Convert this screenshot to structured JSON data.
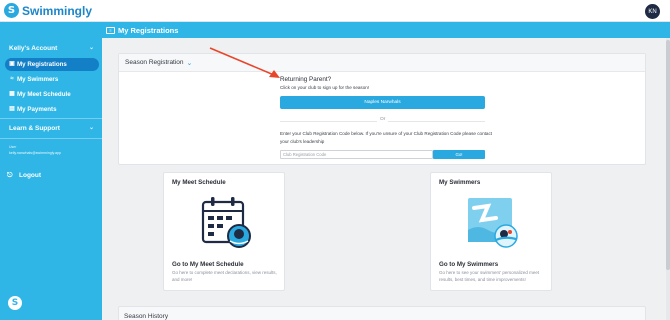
{
  "app": {
    "name": "Swimmingly",
    "user_initials": "KN"
  },
  "sidebar": {
    "account_title": "Kelly's Account",
    "items": [
      {
        "label": "My Registrations",
        "icon": "registration-icon",
        "active": true
      },
      {
        "label": "My Swimmers",
        "icon": "swimmer-icon",
        "active": false
      },
      {
        "label": "My Meet Schedule",
        "icon": "calendar-icon",
        "active": false
      },
      {
        "label": "My Payments",
        "icon": "receipt-icon",
        "active": false
      }
    ],
    "learn_title": "Learn & Support",
    "email_label": "User",
    "email": "kelly.nanwhals@swimmingly.app",
    "logout_label": "Logout"
  },
  "page": {
    "title": "My Registrations"
  },
  "registration": {
    "season_label": "Season Registration",
    "returning_title": "Returning Parent?",
    "returning_subtitle": "Click on your club to sign up for the season!",
    "club_button": "Naples Narwhals",
    "or_text": "Or",
    "code_instructions": "Enter your Club Registration Code below. If you're unsure of your Club Registration Code please contact your club's leadership",
    "code_placeholder": "Club Registration Code",
    "go_button": "Go!"
  },
  "cards": [
    {
      "title": "My Meet Schedule",
      "link": "Go to My Meet Schedule",
      "description": "Go here to complete meet declarations, view results, and more!",
      "icon": "calendar-swimmer-icon"
    },
    {
      "title": "My Swimmers",
      "link": "Go to My Swimmers",
      "description": "Go here to see your swimmers' personalized meet results, best times, and time improvements!",
      "icon": "swimmer-photo-icon"
    }
  ],
  "season_history": {
    "title": "Season History"
  },
  "colors": {
    "brand": "#2fb6e6",
    "active_nav": "#137fc6",
    "button": "#2aa9e0",
    "annotation_arrow": "#e8462b"
  }
}
